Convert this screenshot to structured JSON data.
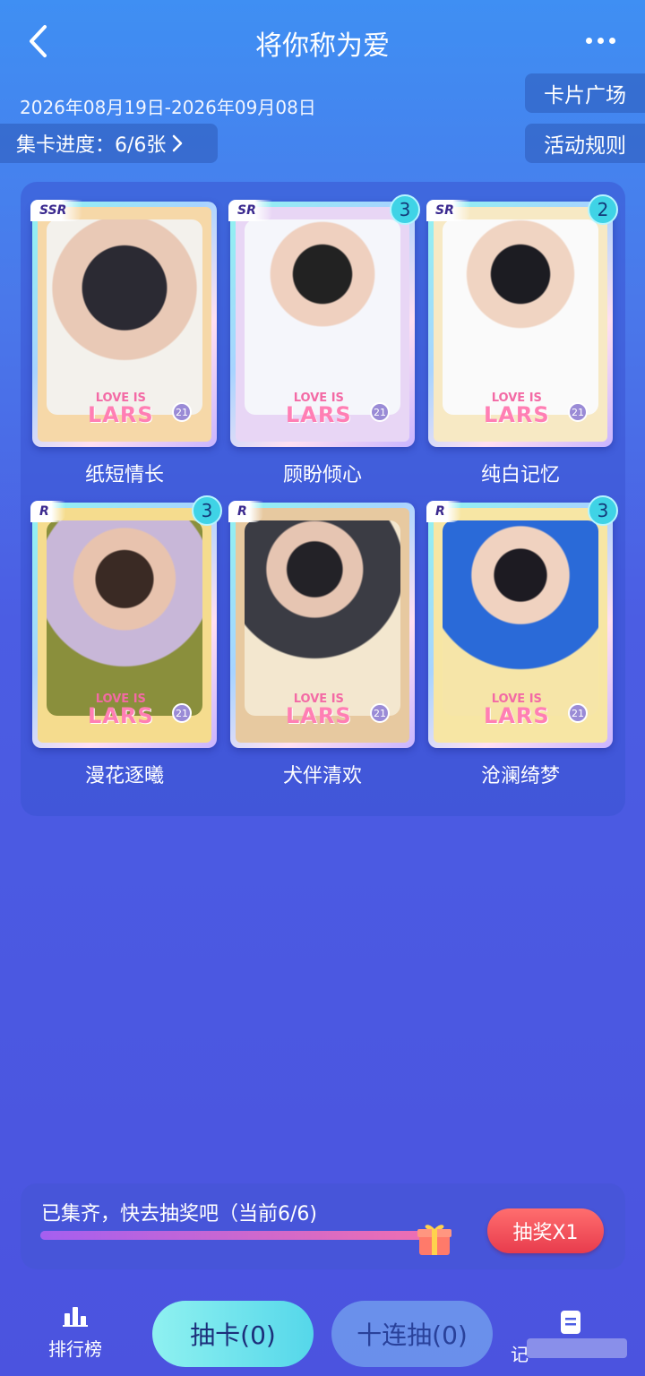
{
  "header": {
    "title": "将你称为爱",
    "date_range": "2026年08月19日-2026年09月08日",
    "progress_label": "集卡进度：6/6张",
    "plaza_button": "卡片广场",
    "rules_button": "活动规则"
  },
  "cards": [
    {
      "name": "纸短情长",
      "rarity": "SSR",
      "count": "",
      "bg": "#f6d8a8"
    },
    {
      "name": "顾盼倾心",
      "rarity": "SR",
      "count": "3",
      "bg": "#e8d6f5"
    },
    {
      "name": "纯白记忆",
      "rarity": "SR",
      "count": "2",
      "bg": "#f7e9c4"
    },
    {
      "name": "漫花逐曦",
      "rarity": "R",
      "count": "3",
      "bg": "#f5dc8e"
    },
    {
      "name": "犬伴清欢",
      "rarity": "R",
      "count": "",
      "bg": "#e7c9a0"
    },
    {
      "name": "沧澜绮梦",
      "rarity": "R",
      "count": "3",
      "bg": "#f7e6a4"
    }
  ],
  "card_logo": {
    "line1": "LOVE IS",
    "line2": "LARS",
    "badge": "21"
  },
  "collect": {
    "text": "已集齐，快去抽奖吧（当前6/6)",
    "progress": 1.0,
    "lottery_button": "抽奖X1"
  },
  "tabbar": {
    "rank_label": "排行榜",
    "draw_button": "抽卡(0)",
    "ten_draw_button": "十连抽(0)",
    "record_label": "记"
  },
  "icons": {
    "back": "chevron-left-icon",
    "more": "more-dots-icon",
    "chevron": "chevron-right-icon",
    "gift": "gift-icon",
    "rank": "bar-chart-icon",
    "record": "document-icon"
  }
}
